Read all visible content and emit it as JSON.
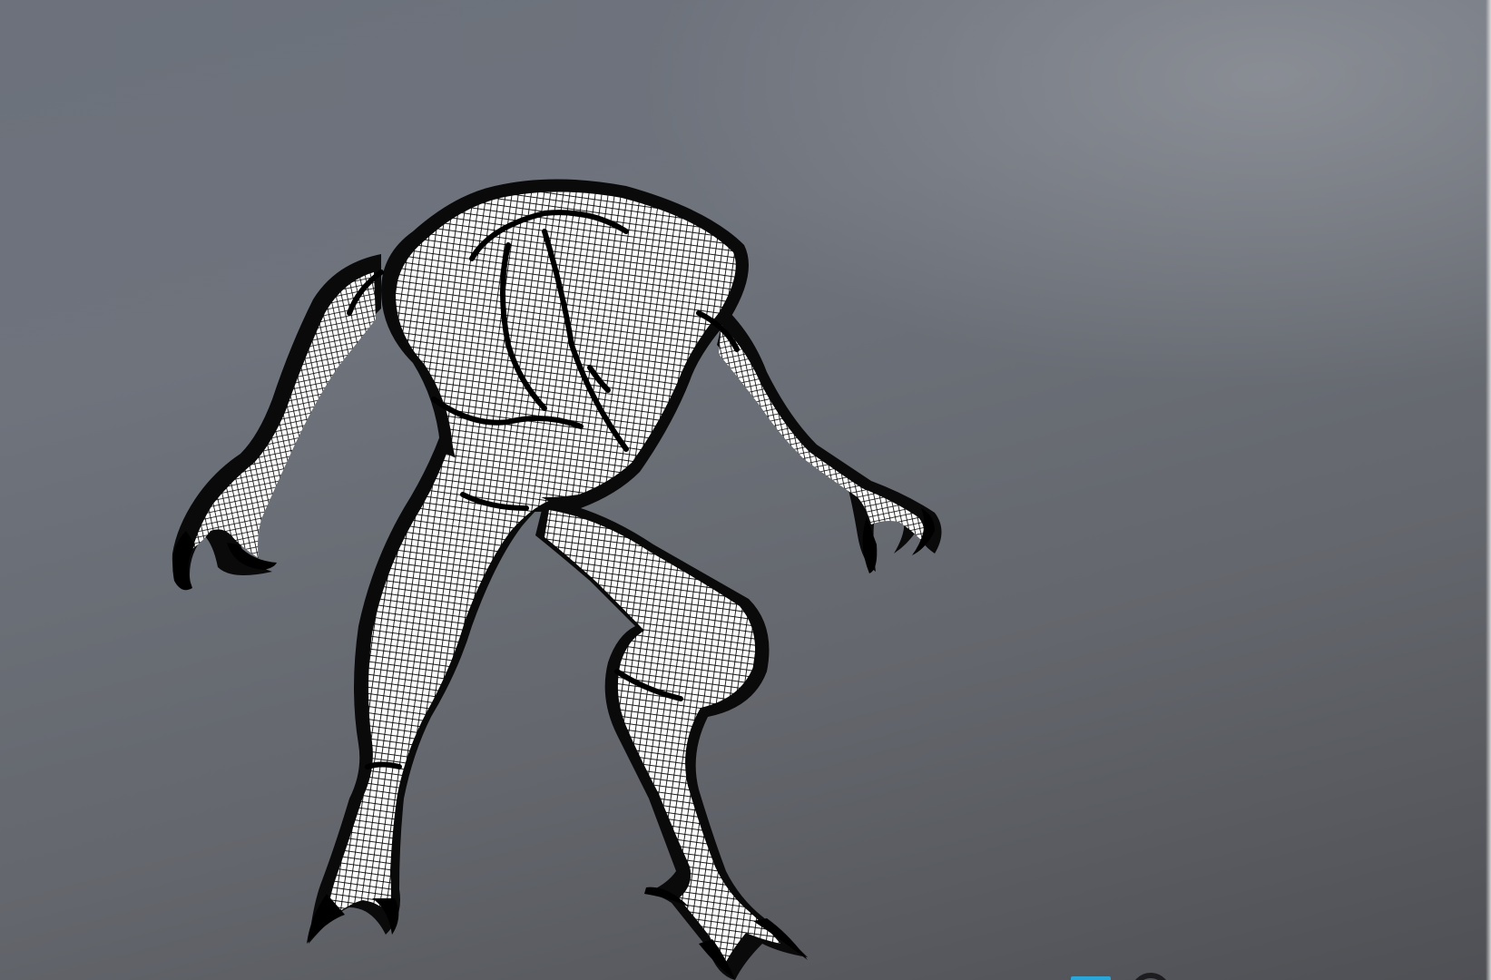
{
  "viewport": {
    "name": "3D viewport",
    "shading_mode": "wireframe",
    "background_colors": {
      "top": "#6c717b",
      "bottom": "#4f5055",
      "highlight": "#a0a2a8"
    },
    "model": {
      "subject": "creature-mesh",
      "wire_color": "#000000",
      "face_color": "#ffffff"
    },
    "axis_gizmo": {
      "icon": "axis-gizmo-icon",
      "colors": [
        "#2aa6d8",
        "#1d1d20"
      ]
    }
  }
}
